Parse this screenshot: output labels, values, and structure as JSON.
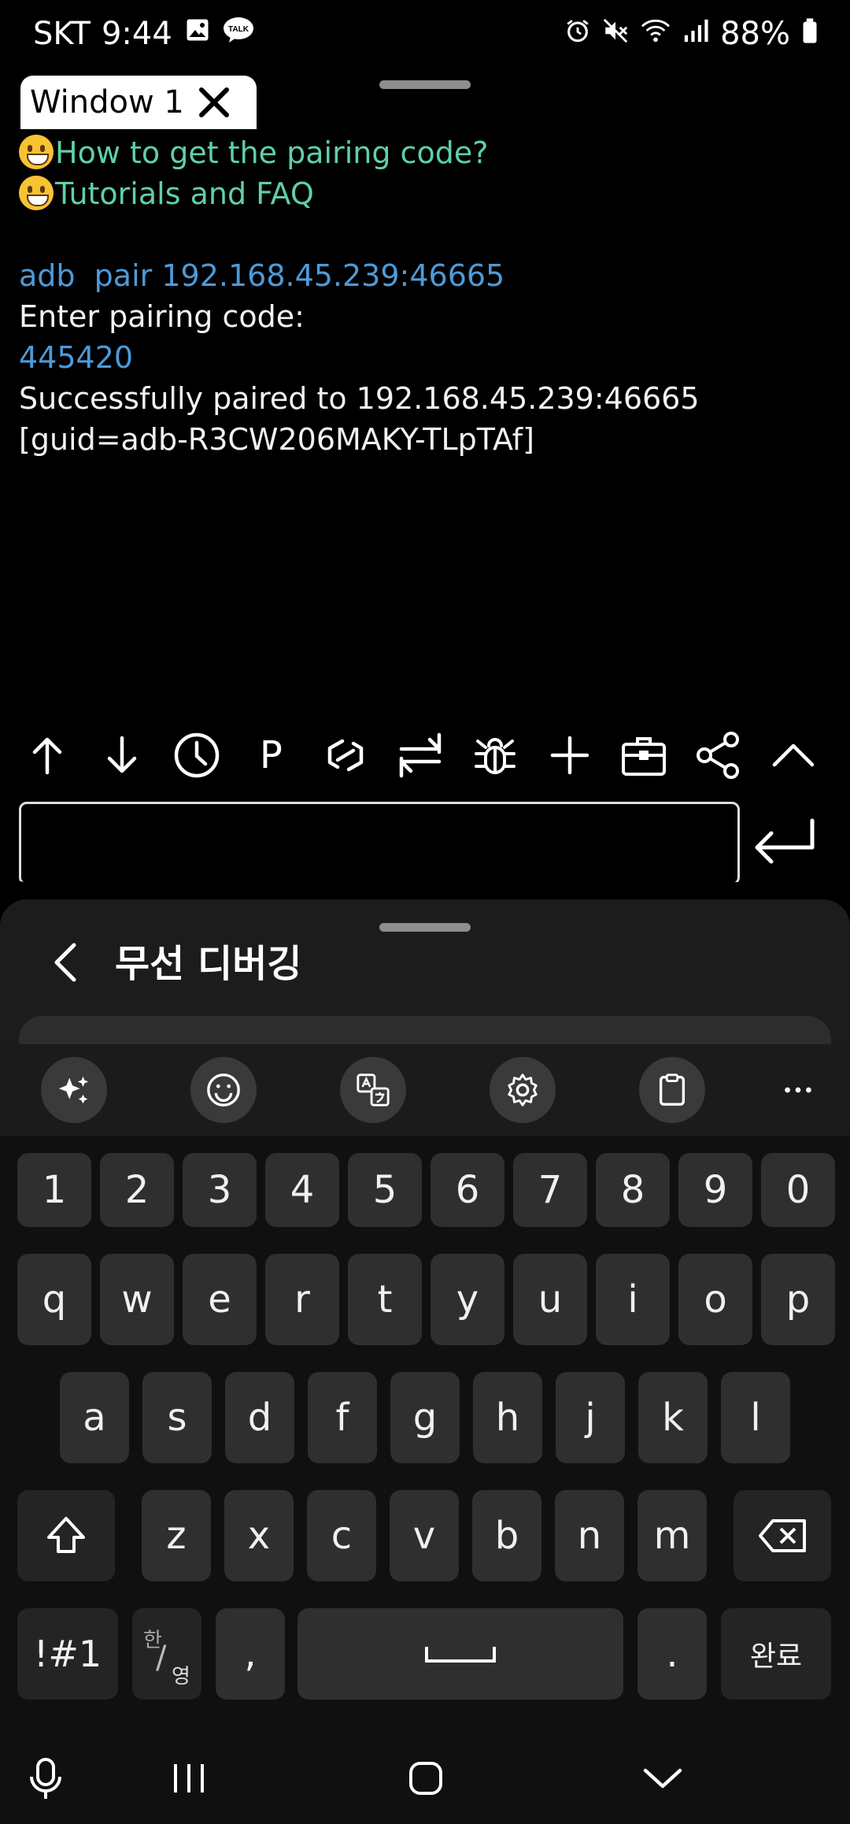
{
  "status_bar": {
    "carrier": "SKT",
    "time": "9:44",
    "battery": "88%",
    "icons": [
      "gallery-icon",
      "talk-icon",
      "alarm-icon",
      "mute-icon",
      "wifi-icon",
      "signal-icon",
      "battery-icon"
    ]
  },
  "window": {
    "tab_title": "Window 1"
  },
  "terminal": {
    "lines": [
      {
        "text": "How to get the pairing code?",
        "emoji": true,
        "color": "green"
      },
      {
        "text": "Tutorials and FAQ",
        "emoji": true,
        "color": "green"
      },
      {
        "text": "",
        "emoji": false,
        "color": "white"
      },
      {
        "text": "adb  pair 192.168.45.239:46665",
        "emoji": false,
        "color": "blue"
      },
      {
        "text": "Enter pairing code:",
        "emoji": false,
        "color": "white"
      },
      {
        "text": "445420",
        "emoji": false,
        "color": "blue"
      },
      {
        "text": "Successfully paired to 192.168.45.239:46665",
        "emoji": false,
        "color": "white"
      },
      {
        "text": "[guid=adb-R3CW206MAKY-TLpTAf]",
        "emoji": false,
        "color": "white"
      }
    ],
    "toolbar": [
      {
        "name": "arrow-up-icon"
      },
      {
        "name": "arrow-down-icon"
      },
      {
        "name": "history-clock-icon"
      },
      {
        "name": "p-text",
        "label": "P"
      },
      {
        "name": "link-icon"
      },
      {
        "name": "transfer-icon"
      },
      {
        "name": "bug-icon"
      },
      {
        "name": "plus-icon"
      },
      {
        "name": "toolbox-icon"
      },
      {
        "name": "share-icon"
      },
      {
        "name": "chevron-up-icon"
      }
    ],
    "input_value": ""
  },
  "settings_window": {
    "title": "무선 디버깅"
  },
  "keyboard": {
    "tools": [
      "sparkle-icon",
      "emoji-icon",
      "translate-icon",
      "settings-icon",
      "clipboard-icon",
      "more-icon"
    ],
    "row_numbers": [
      "1",
      "2",
      "3",
      "4",
      "5",
      "6",
      "7",
      "8",
      "9",
      "0"
    ],
    "row_1": [
      "q",
      "w",
      "e",
      "r",
      "t",
      "y",
      "u",
      "i",
      "o",
      "p"
    ],
    "row_2": [
      "a",
      "s",
      "d",
      "f",
      "g",
      "h",
      "j",
      "k",
      "l"
    ],
    "row_3": [
      "z",
      "x",
      "c",
      "v",
      "b",
      "n",
      "m"
    ],
    "symbols_label": "!#1",
    "lang_top": "한",
    "lang_bottom": "영",
    "comma": ",",
    "period": ".",
    "done_label": "완료"
  },
  "nav_bar": [
    "mic-icon",
    "recents-icon",
    "home-icon",
    "hide-keyboard-icon"
  ]
}
